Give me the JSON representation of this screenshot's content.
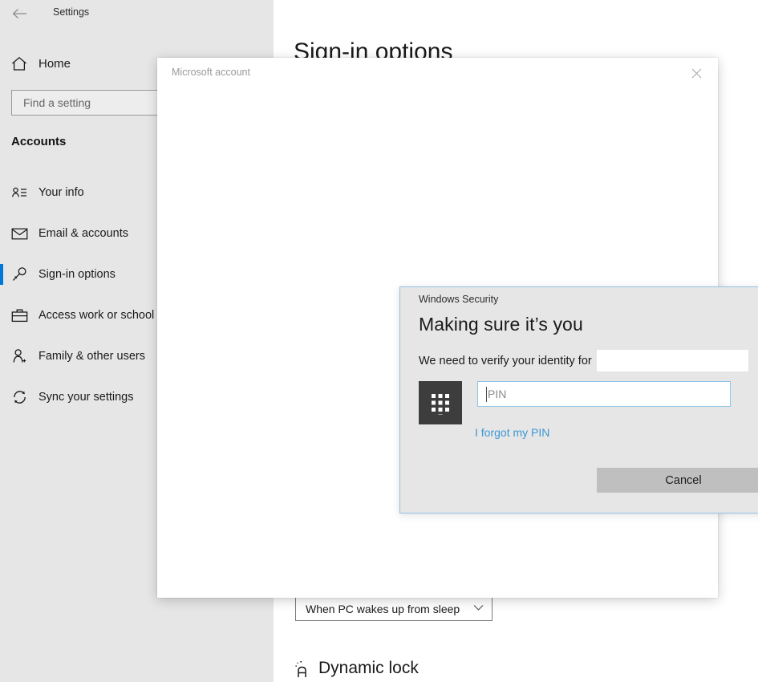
{
  "settings_window": {
    "titlebar": {
      "back_label": "←",
      "back_icon": "back-arrow-icon",
      "title": "Settings"
    },
    "sidebar": {
      "home": {
        "label": "Home",
        "icon": "home-icon"
      },
      "search": {
        "value": "",
        "placeholder": "Find a setting",
        "icon": "search-icon"
      },
      "section_heading": "Accounts",
      "items": [
        {
          "label": "Your info",
          "icon": "contact-card-icon",
          "selected": false
        },
        {
          "label": "Email & accounts",
          "icon": "envelope-icon",
          "selected": false
        },
        {
          "label": "Sign-in options",
          "icon": "key-icon",
          "selected": true
        },
        {
          "label": "Access work or school",
          "icon": "briefcase-icon",
          "selected": false
        },
        {
          "label": "Family & other users",
          "icon": "person-add-icon",
          "selected": false
        },
        {
          "label": "Sync your settings",
          "icon": "sync-icon",
          "selected": false
        }
      ],
      "accent_color": "#0078d7"
    },
    "content": {
      "page_heading": "Sign-in options",
      "wake_dropdown": {
        "value": "When PC wakes up from sleep",
        "chevron_icon": "chevron-down-icon"
      },
      "dynamic_lock": {
        "label": "Dynamic lock",
        "icon": "dynamic-lock-icon"
      }
    }
  },
  "ms_account_window": {
    "title": "Microsoft account",
    "close_label": "✕",
    "close_icon": "close-icon"
  },
  "security_dialog": {
    "title": "Windows Security",
    "close_label": "✕",
    "close_icon": "close-icon",
    "heading": "Making sure it’s you",
    "verify_text": "We need to verify your identity for",
    "account_redacted": "",
    "pin_icon": "pin-keypad-icon",
    "pin_input": {
      "value": "",
      "placeholder": "PIN"
    },
    "forgot_pin_link": "I forgot my PIN",
    "cancel_label": "Cancel",
    "border_color": "#8ec3e6",
    "link_color": "#3c97d4"
  }
}
